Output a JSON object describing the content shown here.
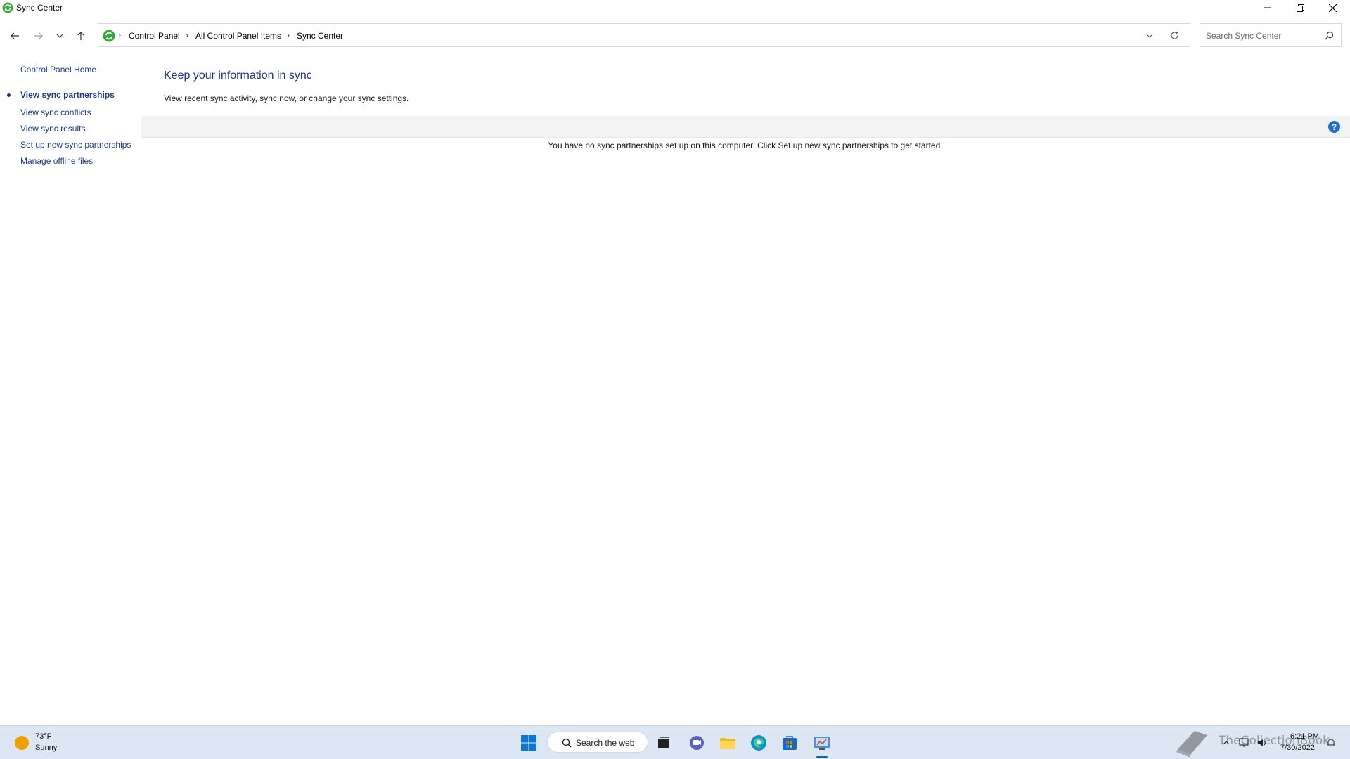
{
  "window": {
    "title": "Sync Center"
  },
  "address_bar": {
    "breadcrumbs": [
      "Control Panel",
      "All Control Panel Items",
      "Sync Center"
    ],
    "search_placeholder": "Search Sync Center"
  },
  "sidebar": {
    "home": "Control Panel Home",
    "items": [
      {
        "label": "View sync partnerships",
        "active": true
      },
      {
        "label": "View sync conflicts",
        "active": false
      },
      {
        "label": "View sync results",
        "active": false
      },
      {
        "label": "Set up new sync partnerships",
        "active": false
      },
      {
        "label": "Manage offline files",
        "active": false
      }
    ]
  },
  "main": {
    "heading": "Keep your information in sync",
    "subtext": "View recent sync activity, sync now, or change your sync settings.",
    "empty_message": "You have no sync partnerships set up on this computer. Click Set up new sync partnerships to get started.",
    "help_label": "?"
  },
  "taskbar": {
    "weather_temp": "73°F",
    "weather_condition": "Sunny",
    "search_label": "Search the web",
    "watermark": "TheCollectionBook",
    "time": "6:21 PM",
    "date": "7/30/2022"
  },
  "colors": {
    "link": "#1a3a8c",
    "heading": "#1e3287",
    "accent": "#0067c0",
    "taskbar": "#dde7f3"
  }
}
